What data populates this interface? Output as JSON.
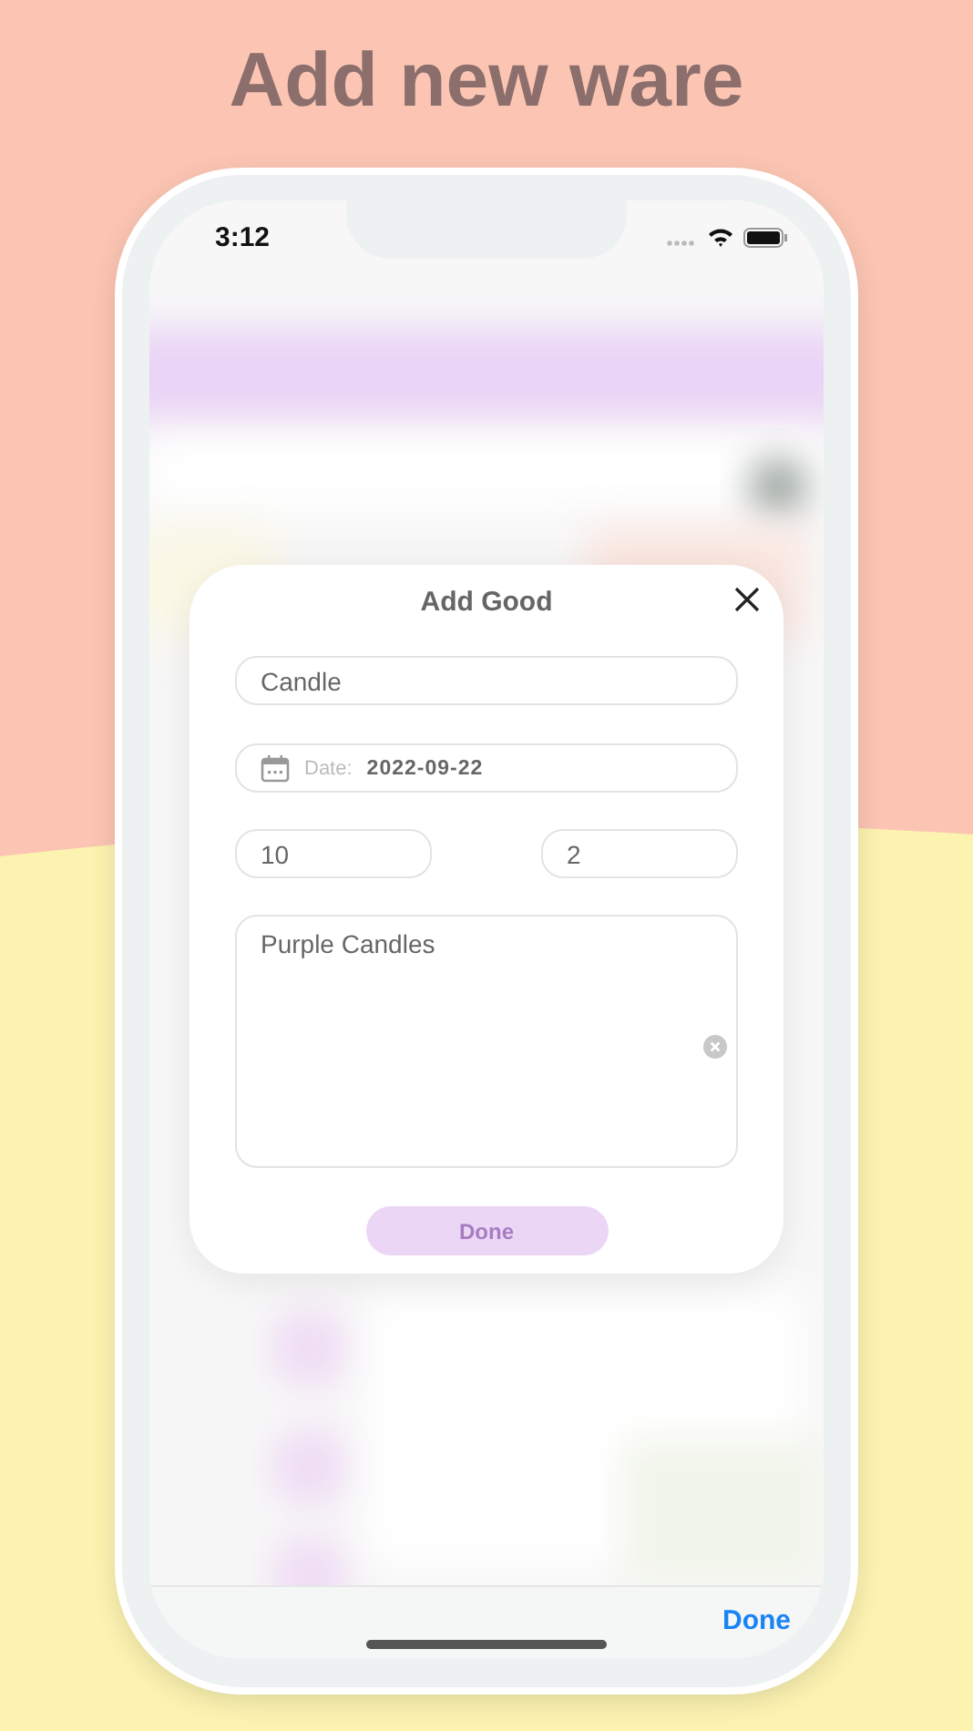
{
  "headline": "Add new ware",
  "status_bar": {
    "time": "3:12"
  },
  "dialog": {
    "title": "Add Good",
    "name_field": {
      "value": "Candle"
    },
    "date_field": {
      "label": "Date:",
      "value": "2022-09-22"
    },
    "quantity_fields": [
      {
        "value": "10"
      },
      {
        "value": "2"
      }
    ],
    "note_field": {
      "value": "Purple Candles"
    },
    "done_button": {
      "label": "Done",
      "disabled": true
    }
  },
  "keyboard_toolbar": {
    "done": "Done"
  }
}
